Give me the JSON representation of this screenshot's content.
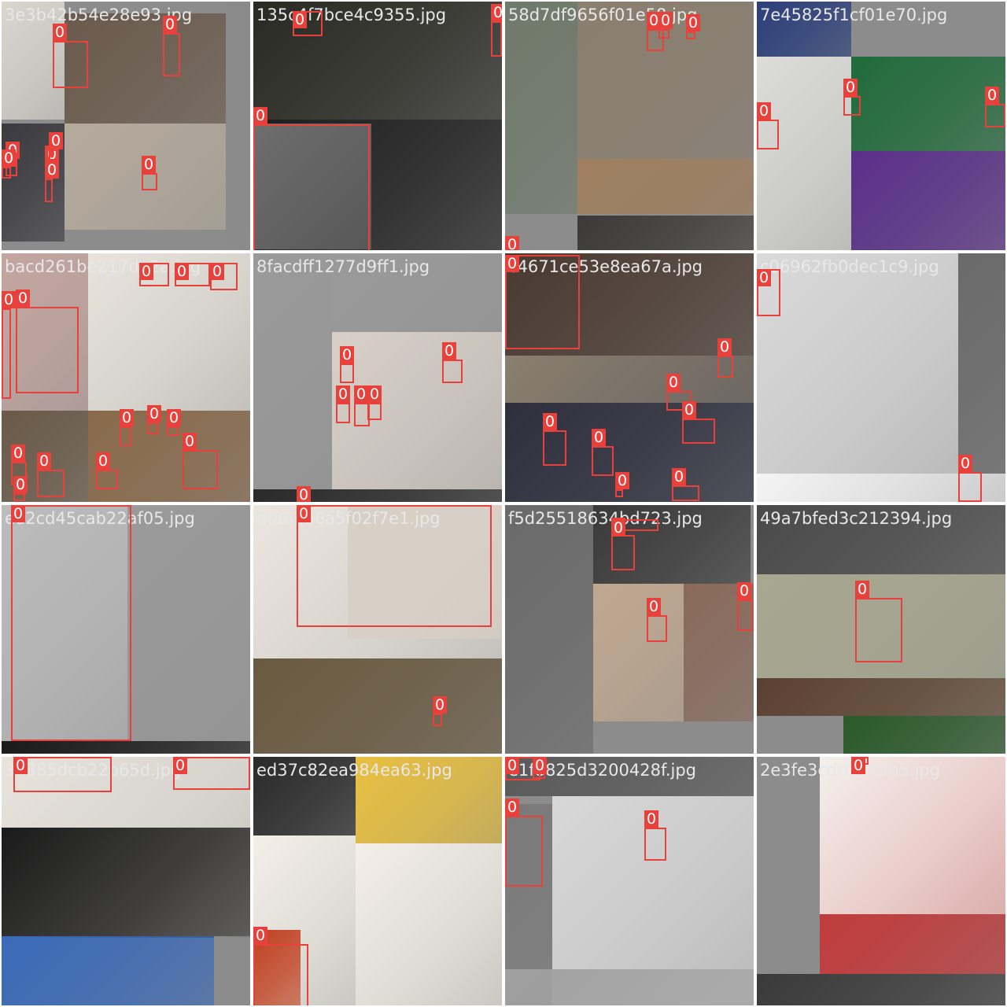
{
  "mosaic": {
    "tiles": [
      {
        "filename": "3e3b42b54e28e93.jpg",
        "palette": [
          "#d9d6cf",
          "#6b5a4c",
          "#3b3a40",
          "#b5aa9c",
          "#8a8a8a"
        ],
        "boxes": [
          {
            "label": "0"
          },
          {
            "label": "0"
          },
          {
            "label": "0"
          },
          {
            "label": "0"
          },
          {
            "label": "0"
          },
          {
            "label": "0"
          },
          {
            "label": "0"
          },
          {
            "label": "0"
          }
        ]
      },
      {
        "filename": "135c4f7bce4c9355.jpg",
        "palette": [
          "#2a2a24",
          "#4a4433",
          "#9a9a9a",
          "#1e1e1e",
          "#6e6e6e"
        ],
        "boxes": [
          {
            "label": "0"
          },
          {
            "label": "0"
          },
          {
            "label": "0"
          }
        ]
      },
      {
        "filename": "58d7df9656f01e58.jpg",
        "palette": [
          "#6f7a6a",
          "#8a7e6e",
          "#3c3a36",
          "#c8b8a8",
          "#a08060"
        ],
        "boxes": [
          {
            "label": "0"
          },
          {
            "label": "0"
          },
          {
            "label": "0"
          },
          {
            "label": "0"
          }
        ]
      },
      {
        "filename": "7e45825f1cf01e70.jpg",
        "palette": [
          "#dcdcd8",
          "#2b3f7a",
          "#1f6b3a",
          "#5a2f8a",
          "#c77a3a"
        ],
        "boxes": [
          {
            "label": "0"
          },
          {
            "label": "0"
          },
          {
            "label": "0"
          }
        ]
      },
      {
        "filename": "bacd261be217de2a.jpg",
        "palette": [
          "#a89078",
          "#c4a6a0",
          "#6a5a48",
          "#e8e4dc",
          "#8a6a4a"
        ],
        "boxes": [
          {
            "label": "0"
          },
          {
            "label": "0"
          },
          {
            "label": "0"
          },
          {
            "label": "0"
          },
          {
            "label": "0"
          },
          {
            "label": "0"
          },
          {
            "label": "0"
          },
          {
            "label": "0"
          },
          {
            "label": "0"
          },
          {
            "label": "0"
          },
          {
            "label": "0"
          },
          {
            "label": "0"
          },
          {
            "label": "0"
          }
        ]
      },
      {
        "filename": "8facdff1277d9ff1.jpg",
        "palette": [
          "#9a9a9a",
          "#2a2a2a",
          "#d8d0c8",
          "#5a4a3c",
          "#3a6a8a"
        ],
        "boxes": [
          {
            "label": "0"
          },
          {
            "label": "0"
          },
          {
            "label": "0"
          },
          {
            "label": "0"
          },
          {
            "label": "0"
          },
          {
            "label": "0"
          }
        ]
      },
      {
        "filename": "c4671ce53e8ea67a.jpg",
        "palette": [
          "#4a3a30",
          "#8a8070",
          "#2a2a3a",
          "#c0b0a0",
          "#b03030"
        ],
        "boxes": [
          {
            "label": "0"
          },
          {
            "label": "0"
          },
          {
            "label": "0"
          },
          {
            "label": "0"
          },
          {
            "label": "0"
          },
          {
            "label": "0"
          },
          {
            "label": "0"
          },
          {
            "label": "0"
          },
          {
            "label": "0"
          }
        ]
      },
      {
        "filename": "c06962fb0dec1c9.jpg",
        "palette": [
          "#dadada",
          "#f4f4f4",
          "#6a6a6a",
          "#2a2a2a",
          "#9a8070"
        ],
        "boxes": [
          {
            "label": "0"
          },
          {
            "label": "0"
          }
        ]
      },
      {
        "filename": "ed2cd45cab22af05.jpg",
        "palette": [
          "#d8ccc0",
          "#1a1a1a",
          "#9a9a9a",
          "#6a6a6a",
          "#bcbcbc"
        ],
        "boxes": [
          {
            "label": "0"
          }
        ]
      },
      {
        "filename": "df86eb6a5f02f7e1.jpg",
        "palette": [
          "#d8cfc4",
          "#ebe6de",
          "#1a1612",
          "#6a5a40",
          "#c0b8b0"
        ],
        "boxes": [
          {
            "label": "0"
          },
          {
            "label": "0"
          }
        ]
      },
      {
        "filename": "f5d25518634bd723.jpg",
        "palette": [
          "#6a6a6a",
          "#3a3a3a",
          "#c0a890",
          "#2a2a30",
          "#8a6a5a"
        ],
        "boxes": [
          {
            "label": "0"
          },
          {
            "label": "0"
          },
          {
            "label": "0"
          },
          {
            "label": "0"
          },
          {
            "label": "0"
          }
        ]
      },
      {
        "filename": "49a7bfed3c212394.jpg",
        "palette": [
          "#4a4a4a",
          "#a8a890",
          "#d8d4c0",
          "#5a4030",
          "#2a5a2a"
        ],
        "boxes": [
          {
            "label": "0"
          }
        ]
      },
      {
        "filename": "34385dcb22b65d.jpg",
        "palette": [
          "#e8e4dc",
          "#1a1a1a",
          "#b08068",
          "#3a6ab8",
          "#8c8c8c"
        ],
        "boxes": [
          {
            "label": "0"
          },
          {
            "label": "0"
          }
        ]
      },
      {
        "filename": "ed37c82ea984ea63.jpg",
        "palette": [
          "#e8c040",
          "#f4f0e8",
          "#c04020",
          "#6a5a3a",
          "#2a2a2a"
        ],
        "boxes": [
          {
            "label": "0"
          }
        ]
      },
      {
        "filename": "e1f8825d3200428f.jpg",
        "palette": [
          "#7a7a7a",
          "#d8d8d8",
          "#3a3a3a",
          "#a0a0a0",
          "#5a5a5a"
        ],
        "boxes": [
          {
            "label": "0"
          },
          {
            "label": "0"
          },
          {
            "label": "0"
          },
          {
            "label": "0"
          }
        ]
      },
      {
        "filename": "2e3fe3cdd90c9b5.jpg",
        "palette": [
          "#8c8c8c",
          "#c83030",
          "#f4f0ec",
          "#3a3a3a",
          "#d8d4c8"
        ],
        "boxes": [
          {
            "label": "0"
          }
        ]
      }
    ]
  }
}
